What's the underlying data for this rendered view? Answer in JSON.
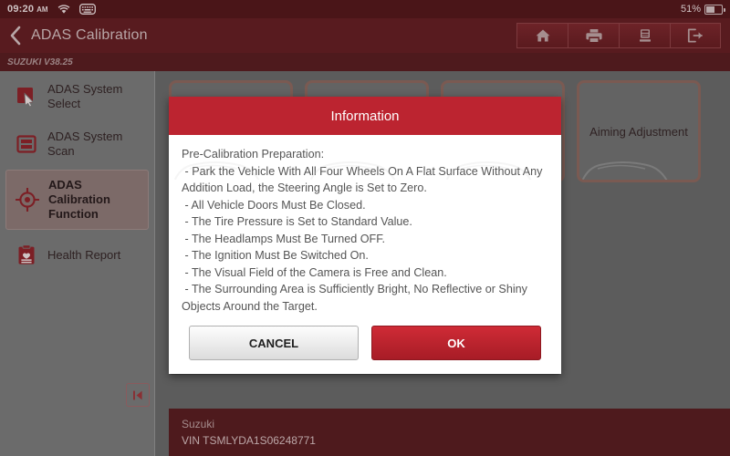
{
  "statusbar": {
    "time": "09:20",
    "ampm": "AM",
    "wifi_icon": "wifi-icon",
    "keyboard_icon": "keyboard-icon",
    "battery_percent": "51%",
    "battery_level": 51,
    "battery_icon": "battery-icon"
  },
  "titlebar": {
    "back_icon": "back-chevron-icon",
    "title": "ADAS Calibration",
    "buttons": [
      {
        "name": "home-button",
        "icon": "home-icon"
      },
      {
        "name": "print-button",
        "icon": "printer-icon"
      },
      {
        "name": "save-report-button",
        "icon": "save-report-icon"
      },
      {
        "name": "exit-button",
        "icon": "exit-icon"
      }
    ]
  },
  "version_bar": {
    "text": "SUZUKI V38.25"
  },
  "sidebar": {
    "items": [
      {
        "label": "ADAS System Select",
        "icon": "cursor-select-icon",
        "active": false
      },
      {
        "label": "ADAS System Scan",
        "icon": "scan-icon",
        "active": false
      },
      {
        "label": "ADAS Calibration Function",
        "icon": "crosshair-target-icon",
        "active": true
      },
      {
        "label": "Health Report",
        "icon": "clipboard-heart-icon",
        "active": false
      }
    ],
    "collapse_button": {
      "label": "|◀",
      "icon": "collapse-panel-icon"
    }
  },
  "content": {
    "cards": [
      {
        "label": "",
        "name": "calibration-card-1"
      },
      {
        "label": "",
        "name": "calibration-card-2"
      },
      {
        "label": "",
        "name": "calibration-card-3"
      },
      {
        "label": "Aiming Adjustment",
        "name": "calibration-card-aiming-adjustment"
      }
    ]
  },
  "vehicle_info": {
    "make": "Suzuki",
    "vin": "VIN TSMLYDA1S06248771"
  },
  "dialog": {
    "title": "Information",
    "body": "Pre-Calibration Preparation:\n - Park the Vehicle With All Four Wheels On A Flat Surface Without Any Addition Load, the Steering Angle is Set to Zero.\n - All Vehicle Doors Must Be Closed.\n - The Tire Pressure is Set to Standard Value.\n - The Headlamps Must Be Turned OFF.\n - The Ignition Must Be Switched On.\n - The Visual Field of the Camera is Free and Clean.\n - The Surrounding Area is Sufficiently Bright, No Reflective or Shiny Objects Around the Target.",
    "cancel_label": "CANCEL",
    "ok_label": "OK"
  },
  "colors": {
    "status_bar": "#4a1518",
    "title_bar": "#581b1f",
    "version_bar": "#4e1a1d",
    "accent_red": "#bc2430",
    "ok_button": "#c02a35",
    "sidebar": "#6b6b6b",
    "content_bg": "#5c5c5c",
    "card_border": "#7a5a52",
    "icon_red": "#7c1f25"
  }
}
